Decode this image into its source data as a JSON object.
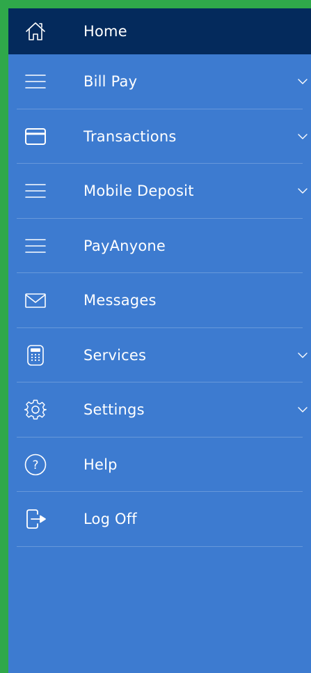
{
  "colors": {
    "frame_border": "#2fa84a",
    "menu_background": "#3d7bd0",
    "active_background": "#042a5c",
    "text": "#ffffff"
  },
  "menu": {
    "items": [
      {
        "label": "Home",
        "icon": "home-icon",
        "active": true,
        "expandable": false
      },
      {
        "label": "Bill Pay",
        "icon": "menu-lines-icon",
        "active": false,
        "expandable": true
      },
      {
        "label": "Transactions",
        "icon": "credit-card-icon",
        "active": false,
        "expandable": true
      },
      {
        "label": "Mobile Deposit",
        "icon": "menu-lines-icon",
        "active": false,
        "expandable": true
      },
      {
        "label": "PayAnyone",
        "icon": "menu-lines-icon",
        "active": false,
        "expandable": false
      },
      {
        "label": "Messages",
        "icon": "envelope-icon",
        "active": false,
        "expandable": false
      },
      {
        "label": "Services",
        "icon": "calculator-icon",
        "active": false,
        "expandable": true
      },
      {
        "label": "Settings",
        "icon": "gear-icon",
        "active": false,
        "expandable": true
      },
      {
        "label": "Help",
        "icon": "help-circle-icon",
        "active": false,
        "expandable": false
      },
      {
        "label": "Log Off",
        "icon": "logout-icon",
        "active": false,
        "expandable": false
      }
    ]
  }
}
